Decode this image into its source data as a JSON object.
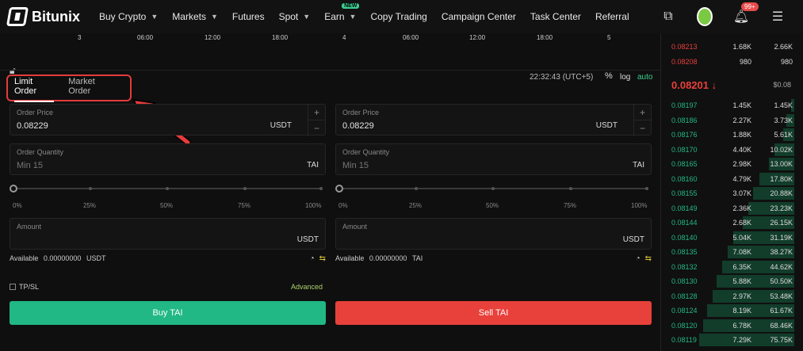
{
  "nav": {
    "brand": "Bitunix",
    "menu": [
      {
        "label": "Buy Crypto",
        "caret": true
      },
      {
        "label": "Markets",
        "caret": true
      },
      {
        "label": "Futures",
        "caret": false
      },
      {
        "label": "Spot",
        "caret": true
      },
      {
        "label": "Earn",
        "caret": true,
        "badge": "NEW"
      },
      {
        "label": "Copy Trading",
        "caret": false
      },
      {
        "label": "Campaign Center",
        "caret": false
      },
      {
        "label": "Task Center",
        "caret": false
      },
      {
        "label": "Referral",
        "caret": false
      }
    ],
    "notifications": "99+"
  },
  "chart_axis": [
    "3",
    "06:00",
    "12:00",
    "18:00",
    "4",
    "06:00",
    "12:00",
    "18:00",
    "5"
  ],
  "chart_footer": {
    "time": "22:32:43 (UTC+5)",
    "pct": "%",
    "log": "log",
    "auto": "auto"
  },
  "order_tabs": {
    "limit": "Limit Order",
    "market": "Market Order"
  },
  "buy": {
    "price_label": "Order Price",
    "price": "0.08229",
    "price_unit": "USDT",
    "qty_label": "Order Quantity",
    "qty_placeholder": "Min 15",
    "qty_unit": "TAI",
    "amount_label": "Amount",
    "amount_unit": "USDT",
    "available_label": "Available",
    "available_value": "0.00000000",
    "available_unit": "USDT",
    "button": "Buy TAI"
  },
  "sell": {
    "price_label": "Order Price",
    "price": "0.08229",
    "price_unit": "USDT",
    "qty_label": "Order Quantity",
    "qty_placeholder": "Min 15",
    "qty_unit": "TAI",
    "amount_label": "Amount",
    "amount_unit": "USDT",
    "available_label": "Available",
    "available_value": "0.00000000",
    "available_unit": "TAI",
    "button": "Sell TAI"
  },
  "slider_ticks": [
    "0%",
    "25%",
    "50%",
    "75%",
    "100%"
  ],
  "tpsl": "TP/SL",
  "advanced": "Advanced",
  "orderbook": {
    "asks": [
      {
        "price": "0.08213",
        "qty": "1.68K",
        "total": "2.66K"
      },
      {
        "price": "0.08208",
        "qty": "980",
        "total": "980"
      }
    ],
    "last_price": "0.08201 ↓",
    "last_usd": "$0.08",
    "bids": [
      {
        "price": "0.08197",
        "qty": "1.45K",
        "total": "1.45K",
        "depth": 0.03
      },
      {
        "price": "0.08186",
        "qty": "2.27K",
        "total": "3.73K",
        "depth": 0.08
      },
      {
        "price": "0.08176",
        "qty": "1.88K",
        "total": "5.61K",
        "depth": 0.12
      },
      {
        "price": "0.08170",
        "qty": "4.40K",
        "total": "10.02K",
        "depth": 0.21
      },
      {
        "price": "0.08165",
        "qty": "2.98K",
        "total": "13.00K",
        "depth": 0.27
      },
      {
        "price": "0.08160",
        "qty": "4.79K",
        "total": "17.80K",
        "depth": 0.37
      },
      {
        "price": "0.08155",
        "qty": "3.07K",
        "total": "20.88K",
        "depth": 0.43
      },
      {
        "price": "0.08149",
        "qty": "2.36K",
        "total": "23.23K",
        "depth": 0.48
      },
      {
        "price": "0.08144",
        "qty": "2.68K",
        "total": "26.15K",
        "depth": 0.54
      },
      {
        "price": "0.08140",
        "qty": "5.04K",
        "total": "31.19K",
        "depth": 0.64
      },
      {
        "price": "0.08135",
        "qty": "7.08K",
        "total": "38.27K",
        "depth": 0.7
      },
      {
        "price": "0.08132",
        "qty": "6.35K",
        "total": "44.62K",
        "depth": 0.76
      },
      {
        "price": "0.08130",
        "qty": "5.88K",
        "total": "50.50K",
        "depth": 0.82
      },
      {
        "price": "0.08128",
        "qty": "2.97K",
        "total": "53.48K",
        "depth": 0.86
      },
      {
        "price": "0.08124",
        "qty": "8.19K",
        "total": "61.67K",
        "depth": 0.92
      },
      {
        "price": "0.08120",
        "qty": "6.78K",
        "total": "68.46K",
        "depth": 0.96
      },
      {
        "price": "0.08119",
        "qty": "7.29K",
        "total": "75.75K",
        "depth": 1.0
      }
    ]
  }
}
